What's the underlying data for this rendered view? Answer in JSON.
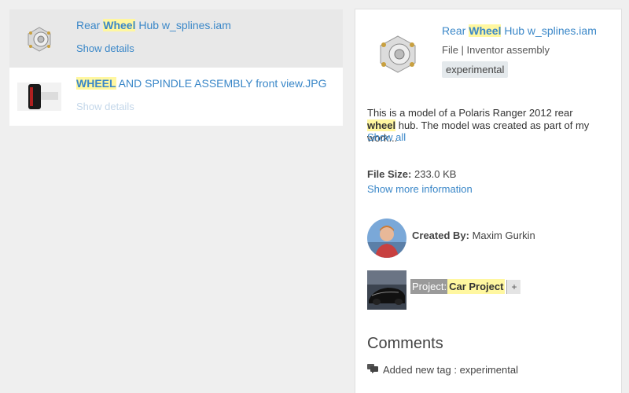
{
  "results": [
    {
      "title_pre": "Rear ",
      "title_hl": "Wheel",
      "title_post": " Hub w_splines.iam",
      "details_label": "Show details",
      "thumb_icon": "wheel-hub-model-icon"
    },
    {
      "title_pre": "",
      "title_hl": "WHEEL",
      "title_post": " AND SPINDLE ASSEMBLY front view.JPG",
      "details_label": "Show details",
      "thumb_icon": "wheel-spindle-photo-icon"
    }
  ],
  "detail": {
    "title_pre": "Rear ",
    "title_hl": "Wheel",
    "title_post": " Hub w_splines.iam",
    "meta": "File | Inventor assembly",
    "tag": "experimental",
    "desc_pre": "This is a model of a Polaris Ranger 2012 rear ",
    "desc_hl": "wheel",
    "desc_post": " hub. The model was created as part of my work...",
    "show_all": "Show all",
    "file_size_label": "File Size:",
    "file_size_value": "233.0 KB",
    "show_more": "Show more information",
    "created_by_label": "Created By:",
    "created_by_value": "Maxim Gurkin",
    "project_label": "Project:",
    "project_name": "Car Project",
    "project_add": "+",
    "comments_heading": "Comments",
    "comment_text": "Added new tag : experimental"
  },
  "colors": {
    "link": "#3a87c8",
    "highlight": "#fff7a0",
    "selected_row": "#e8e8e8",
    "tag_bg": "#e4e9ec"
  }
}
